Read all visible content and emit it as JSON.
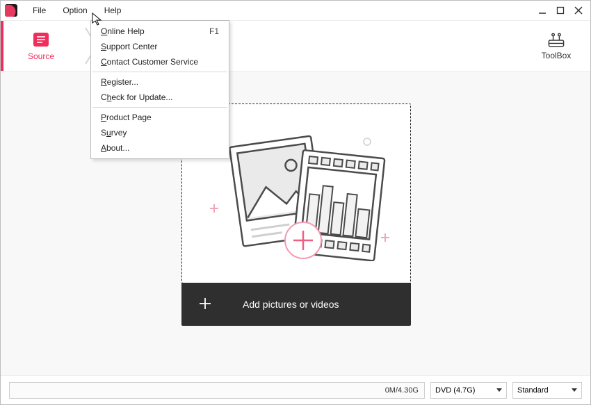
{
  "menubar": {
    "items": [
      "File",
      "Option",
      "Help"
    ]
  },
  "help_menu": {
    "online_help": "Online Help",
    "online_help_shortcut": "F1",
    "support_center": "Support Center",
    "contact": "Contact Customer Service",
    "register": "Register...",
    "check_update": "Check for Update...",
    "product_page": "Product Page",
    "survey": "Survey",
    "about": "About..."
  },
  "steps": {
    "source": "Source",
    "toolbox": "ToolBox"
  },
  "main": {
    "add_label": "Add pictures or videos"
  },
  "bottom": {
    "progress_text": "0M/4.30G",
    "disc_label": "DVD (4.7G)",
    "quality_label": "Standard"
  }
}
